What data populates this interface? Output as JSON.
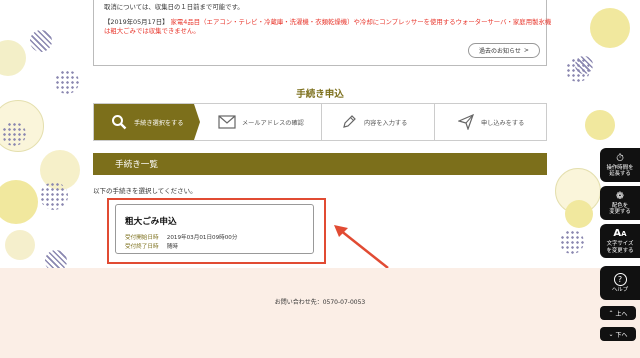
{
  "notice": {
    "line1": "取消については、収集日の１日前まで可能です。",
    "line2_date": "【2019年05月17日】",
    "line2_text": "家電4品目（エアコン・テレビ・冷蔵庫・洗濯機・衣類乾燥機）や冷却にコンプレッサーを使用するウォーターサーバ・家庭用製氷機",
    "line3": "は粗大ごみでは収集できません。",
    "past_news_label": "過去のお知らせ"
  },
  "page_title": "手続き申込",
  "steps": [
    {
      "label": "手続き選択をする",
      "icon": "search-icon",
      "active": true
    },
    {
      "label": "メールアドレスの確認",
      "icon": "mail-icon",
      "active": false
    },
    {
      "label": "内容を入力する",
      "icon": "pencil-icon",
      "active": false
    },
    {
      "label": "申し込みをする",
      "icon": "send-icon",
      "active": false
    }
  ],
  "section_title": "手続き一覧",
  "instruction": "以下の手続きを選択してください。",
  "procedure": {
    "title": "粗大ごみ申込",
    "start_label": "受付開始日時",
    "start_value": "2019年03月01日09時00分",
    "end_label": "受付終了日時",
    "end_value": "随時"
  },
  "footer": {
    "contact": "お問い合わせ先：0570-07-0053"
  },
  "tools": [
    {
      "label1": "操作時間を",
      "label2": "延長する",
      "icon": "timer-icon"
    },
    {
      "label1": "配色を",
      "label2": "変更する",
      "icon": "palette-icon"
    },
    {
      "label1": "文字サイズ",
      "label2": "を変更する",
      "icon": "font-size-icon"
    },
    {
      "label1": "ヘルプ",
      "label2": "",
      "icon": "help-icon"
    }
  ],
  "nav": {
    "up": "上へ",
    "down": "下へ"
  },
  "colors": {
    "accent": "#7c6f1b",
    "highlight": "#e14b33",
    "footer_bg": "#fbeee6",
    "warning_text": "#e8362c"
  }
}
